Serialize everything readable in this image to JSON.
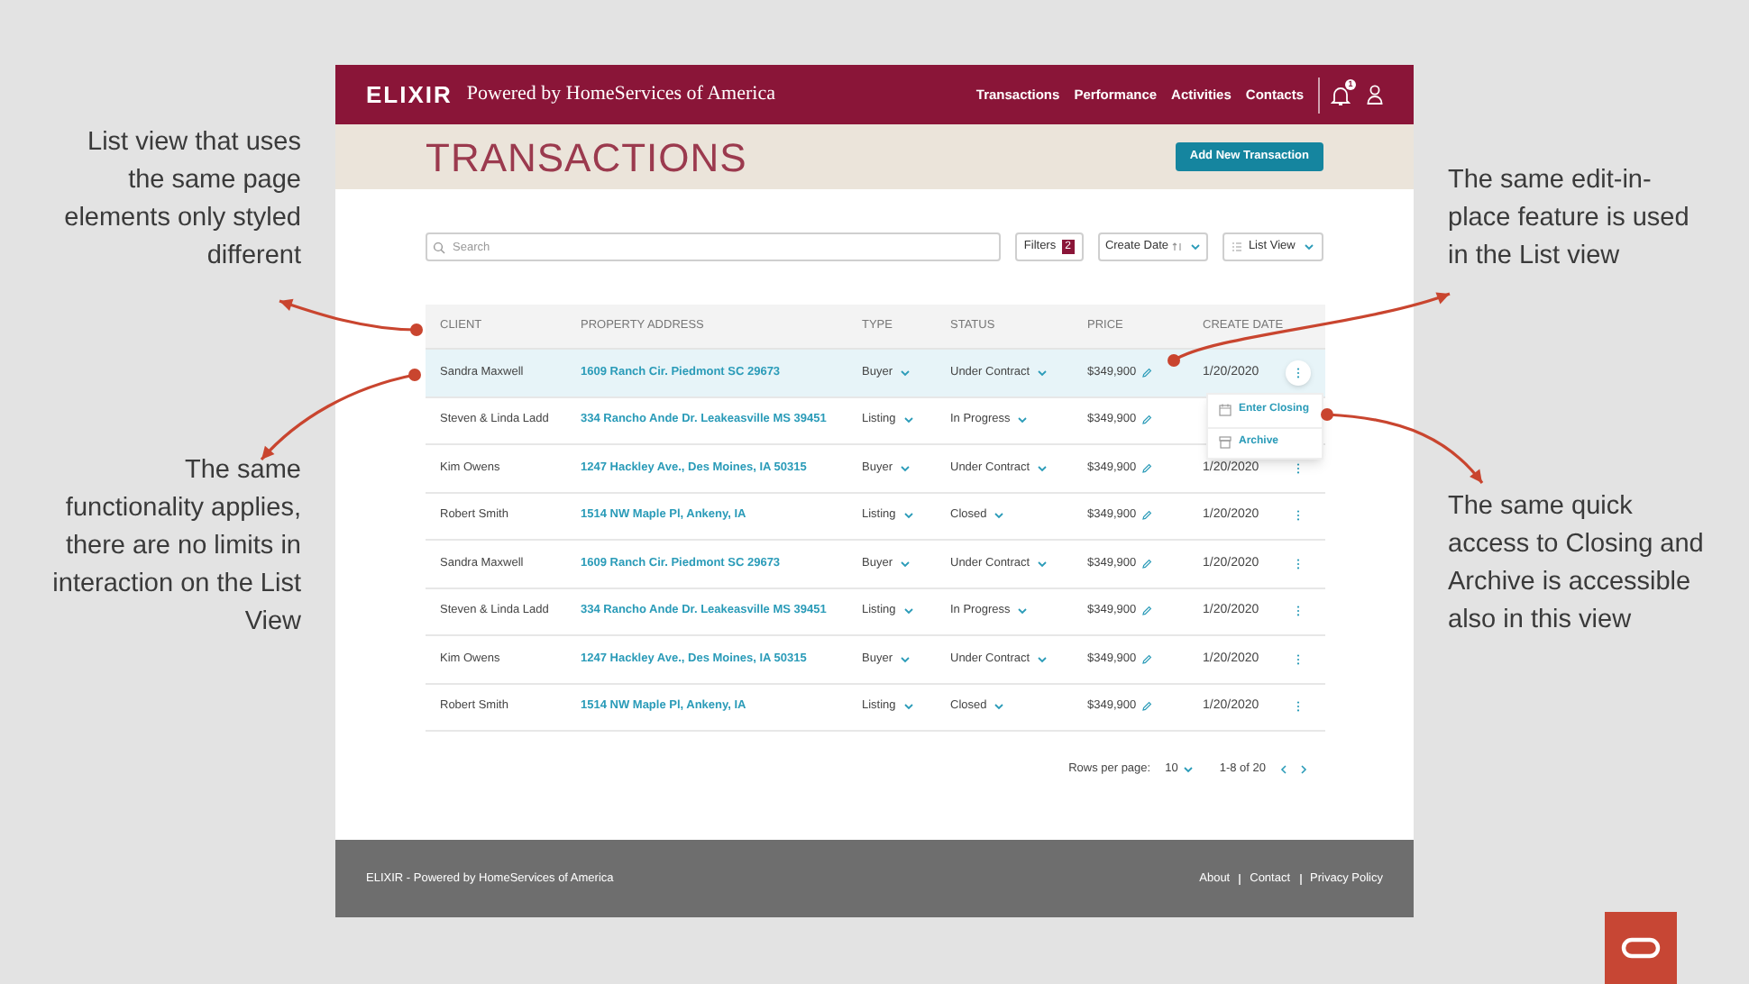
{
  "left_notes": [
    "List view that uses the same page elements only styled different",
    "The same functionality applies, there are no limits in interaction on the List View"
  ],
  "right_notes": [
    "The same edit-in-place feature is used in the List view",
    "The same quick access to Closing and Archive is accessible also in this view"
  ],
  "app": {
    "logo": "ELIXIR",
    "tagline": "Powered by HomeServices of America",
    "nav": [
      {
        "label": "Transactions"
      },
      {
        "label": "Performance"
      },
      {
        "label": "Activities"
      },
      {
        "label": "Contacts"
      }
    ],
    "notification_count": "1",
    "page_title": "TRANSACTIONS",
    "add_button": "Add New Transaction",
    "search": {
      "placeholder": "Search"
    },
    "filters": {
      "label": "Filters",
      "count": "2"
    },
    "sort": {
      "label": "Create Date"
    },
    "view": {
      "label": "List View"
    },
    "table": {
      "columns": [
        "CLIENT",
        "PROPERTY ADDRESS",
        "TYPE",
        "STATUS",
        "PRICE",
        "CREATE DATE"
      ],
      "rows": [
        {
          "client": "Sandra Maxwell",
          "address": "1609 Ranch Cir. Piedmont SC 29673",
          "type": "Buyer",
          "status": "Under Contract",
          "price": "$349,900",
          "date": "1/20/2020",
          "selected": true
        },
        {
          "client": "Steven & Linda Ladd",
          "address": "334 Rancho Ande Dr. Leakeasville MS 39451",
          "type": "Listing",
          "status": "In Progress",
          "price": "$349,900",
          "selected": false
        },
        {
          "client": "Kim Owens",
          "address": "1247 Hackley Ave., Des Moines, IA 50315",
          "type": "Buyer",
          "status": "Under Contract",
          "price": "$349,900",
          "date": "1/20/2020",
          "selected": false
        },
        {
          "client": "Robert Smith",
          "address": "1514 NW Maple Pl, Ankeny, IA",
          "type": "Listing",
          "status": "Closed",
          "price": "$349,900",
          "date": "1/20/2020",
          "selected": false
        },
        {
          "client": "Sandra Maxwell",
          "address": "1609 Ranch Cir. Piedmont SC 29673",
          "type": "Buyer",
          "status": "Under Contract",
          "price": "$349,900",
          "date": "1/20/2020",
          "selected": false
        },
        {
          "client": "Steven & Linda Ladd",
          "address": "334 Rancho Ande Dr. Leakeasville MS 39451",
          "type": "Listing",
          "status": "In Progress",
          "price": "$349,900",
          "date": "1/20/2020",
          "selected": false
        },
        {
          "client": "Kim Owens",
          "address": "1247 Hackley Ave., Des Moines, IA 50315",
          "type": "Buyer",
          "status": "Under Contract",
          "price": "$349,900",
          "date": "1/20/2020",
          "selected": false
        },
        {
          "client": "Robert Smith",
          "address": "1514 NW Maple Pl, Ankeny, IA",
          "type": "Listing",
          "status": "Closed",
          "price": "$349,900",
          "date": "1/20/2020",
          "selected": false
        }
      ]
    },
    "row_menu": [
      {
        "kind": "calendar",
        "label": "Enter Closing"
      },
      {
        "kind": "archive",
        "label": "Archive"
      }
    ],
    "pagination": {
      "rows_label": "Rows per page:",
      "rows_value": "10",
      "range": "1-8 of 20"
    },
    "footer": {
      "text": "ELIXIR - Powered by HomeServices of America",
      "links": [
        {
          "label": "About"
        },
        {
          "label": "Contact"
        },
        {
          "label": "Privacy Policy"
        }
      ]
    }
  }
}
